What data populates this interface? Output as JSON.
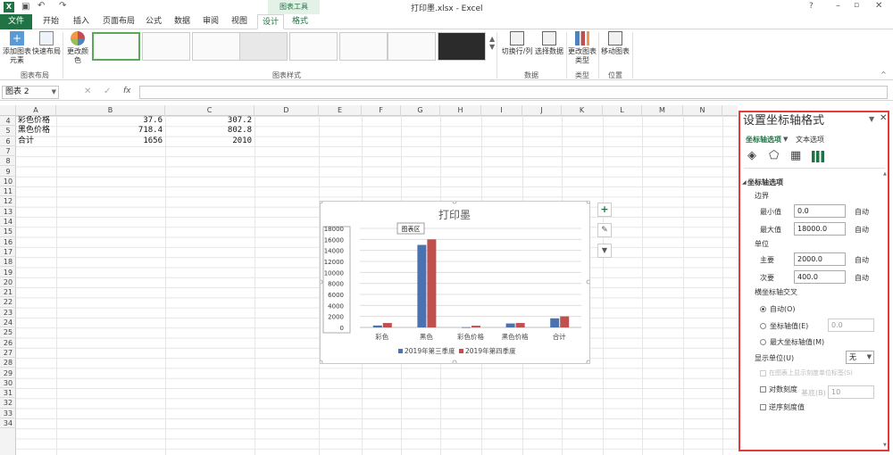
{
  "window": {
    "title": "打印墨.xlsx - Excel",
    "context_label": "图表工具",
    "help": "?"
  },
  "tabs": [
    "文件",
    "开始",
    "插入",
    "页面布局",
    "公式",
    "数据",
    "审阅",
    "视图",
    "设计",
    "格式"
  ],
  "ribbon": {
    "add_element": "添加图表元素",
    "quick_layout": "快速布局",
    "change_color": "更改颜色",
    "switch_row_col": "切换行/列",
    "select_data": "选择数据",
    "change_type": "更改图表类型",
    "move_chart": "移动图表",
    "groups": {
      "layout": "图表布局",
      "styles": "图表样式",
      "data": "数据",
      "type": "类型",
      "location": "位置"
    }
  },
  "formula_bar": {
    "name_box": "图表 2",
    "fx": "fx",
    "value": ""
  },
  "columns": [
    "A",
    "B",
    "C",
    "D",
    "E",
    "F",
    "G",
    "H",
    "I",
    "J",
    "K",
    "L",
    "M",
    "N"
  ],
  "rows": [
    "4",
    "5",
    "6",
    "7",
    "8",
    "9",
    "10",
    "11",
    "12",
    "13",
    "14",
    "15",
    "16",
    "17",
    "18",
    "19",
    "20",
    "21",
    "22",
    "23",
    "24",
    "25",
    "26",
    "27",
    "28",
    "29",
    "30",
    "31",
    "32",
    "33",
    "34"
  ],
  "cells": [
    {
      "a": "彩色价格",
      "b": "37.6",
      "c": "307.2"
    },
    {
      "a": "黑色价格",
      "b": "718.4",
      "c": "802.8"
    },
    {
      "a": "合计",
      "b": "1656",
      "c": "2010"
    }
  ],
  "chart_data": {
    "type": "bar",
    "title": "打印墨",
    "tooltip": "图表区",
    "categories": [
      "彩色",
      "黑色",
      "彩色价格",
      "黑色价格",
      "合计"
    ],
    "series": [
      {
        "name": "2019年第三季度",
        "values": [
          350,
          15000,
          37.6,
          718.4,
          1656
        ],
        "color": "#4a72b0"
      },
      {
        "name": "2019年第四季度",
        "values": [
          800,
          16000,
          307.2,
          802.8,
          2010
        ],
        "color": "#c0504d"
      }
    ],
    "yticks": [
      "18000",
      "16000",
      "14000",
      "12000",
      "10000",
      "8000",
      "6000",
      "4000",
      "2000",
      "0"
    ],
    "ylim": [
      0,
      18000
    ],
    "legend": "bottom"
  },
  "chart_buttons": {
    "add": "+",
    "style": "✎",
    "filter": "▼"
  },
  "panel": {
    "title": "设置坐标轴格式",
    "tab_axis": "坐标轴选项",
    "tab_text": "文本选项",
    "section": "坐标轴选项",
    "bounds": "边界",
    "min_label": "最小值",
    "min_value": "0.0",
    "max_label": "最大值",
    "max_value": "18000.0",
    "auto": "自动",
    "units": "单位",
    "major_label": "主要",
    "major_value": "2000.0",
    "minor_label": "次要",
    "minor_value": "400.0",
    "cross_label": "横坐标轴交叉",
    "radio_auto": "自动(O)",
    "radio_value": "坐标轴值(E)",
    "radio_value_input": "0.0",
    "radio_max": "最大坐标轴值(M)",
    "display_units": "显示单位(U)",
    "display_units_value": "无",
    "show_units_label": "在图表上显示刻度单位标签(S)",
    "log_label": "对数刻度",
    "base_label": "基底(B)",
    "base_value": "10",
    "reverse_label": "逆序刻度值"
  }
}
